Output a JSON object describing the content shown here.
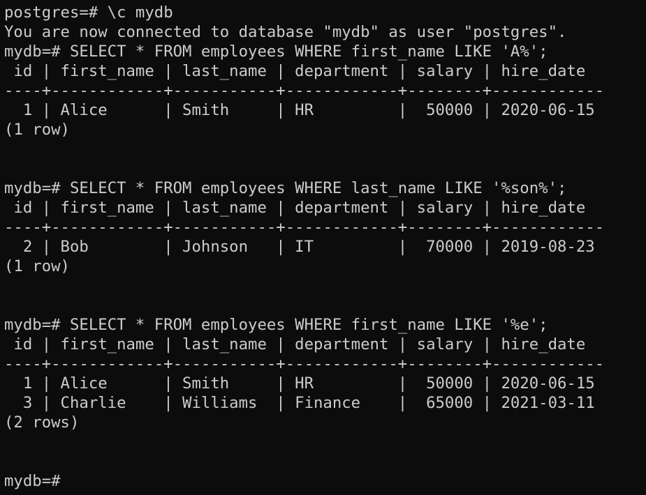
{
  "terminal": {
    "lines": [
      "postgres=# \\c mydb",
      "You are now connected to database \"mydb\" as user \"postgres\".",
      "mydb=# SELECT * FROM employees WHERE first_name LIKE 'A%';",
      " id | first_name | last_name | department | salary | hire_date",
      "----+------------+-----------+------------+--------+------------",
      "  1 | Alice      | Smith     | HR         |  50000 | 2020-06-15",
      "(1 row)",
      "",
      "",
      "mydb=# SELECT * FROM employees WHERE last_name LIKE '%son%';",
      " id | first_name | last_name | department | salary | hire_date",
      "----+------------+-----------+------------+--------+------------",
      "  2 | Bob        | Johnson   | IT         |  70000 | 2019-08-23",
      "(1 row)",
      "",
      "",
      "mydb=# SELECT * FROM employees WHERE first_name LIKE '%e';",
      " id | first_name | last_name | department | salary | hire_date",
      "----+------------+-----------+------------+--------+------------",
      "  1 | Alice      | Smith     | HR         |  50000 | 2020-06-15",
      "  3 | Charlie    | Williams  | Finance    |  65000 | 2021-03-11",
      "(2 rows)",
      "",
      "",
      "mydb=#"
    ]
  }
}
